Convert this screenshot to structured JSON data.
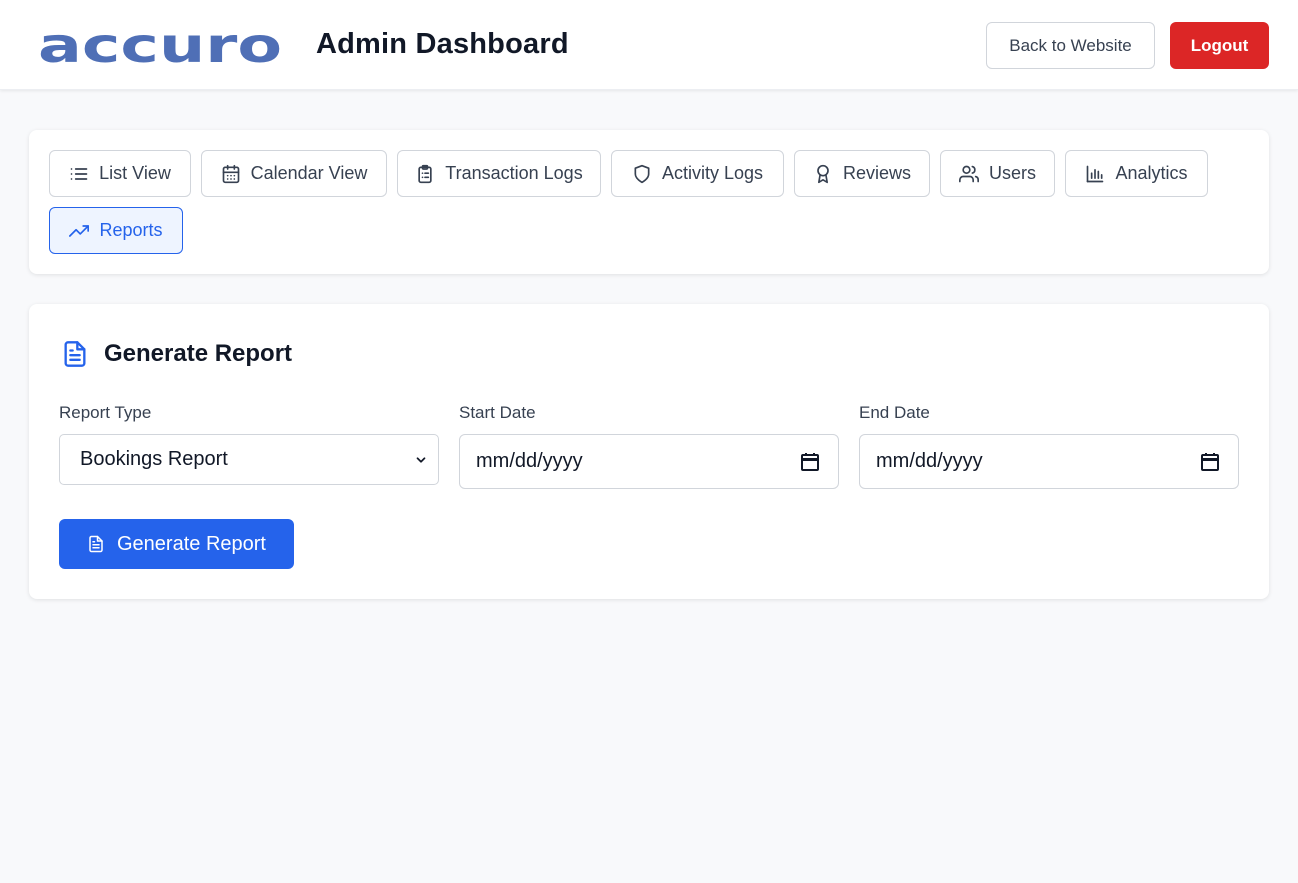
{
  "header": {
    "logo_text": "accuro",
    "title": "Admin Dashboard",
    "back_label": "Back to Website",
    "logout_label": "Logout"
  },
  "tabs": [
    {
      "label": "List View",
      "icon": "list-icon",
      "active": false
    },
    {
      "label": "Calendar View",
      "icon": "calendar-icon",
      "active": false
    },
    {
      "label": "Transaction Logs",
      "icon": "clipboard-list-icon",
      "active": false
    },
    {
      "label": "Activity Logs",
      "icon": "shield-icon",
      "active": false
    },
    {
      "label": "Reviews",
      "icon": "award-icon",
      "active": false
    },
    {
      "label": "Users",
      "icon": "users-icon",
      "active": false
    },
    {
      "label": "Analytics",
      "icon": "bar-chart-icon",
      "active": false
    },
    {
      "label": "Reports",
      "icon": "trending-up-icon",
      "active": true
    }
  ],
  "report": {
    "title": "Generate Report",
    "report_type_label": "Report Type",
    "report_type_value": "Bookings Report",
    "start_date_label": "Start Date",
    "start_date_placeholder": "mm/dd/yyyy",
    "end_date_label": "End Date",
    "end_date_placeholder": "mm/dd/yyyy",
    "generate_label": "Generate Report"
  },
  "colors": {
    "brand": "#4f6fb6",
    "primary": "#2563eb",
    "danger": "#dc2626",
    "active_tab_bg": "#eef4ff"
  }
}
